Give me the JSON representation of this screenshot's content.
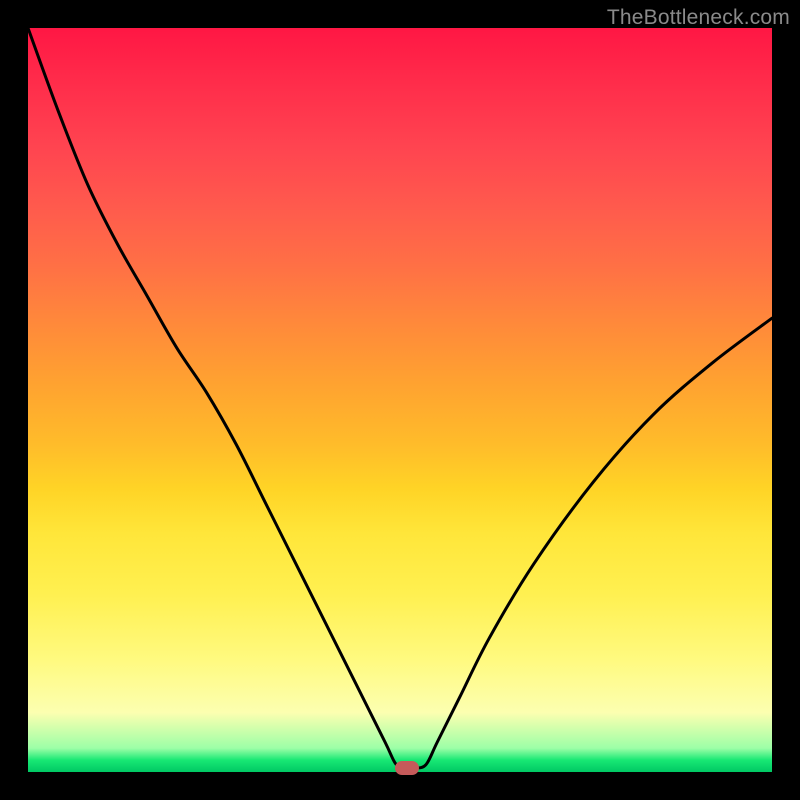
{
  "watermark": "TheBottleneck.com",
  "colors": {
    "frame": "#000000",
    "curve": "#000000",
    "marker": "#c55a5a",
    "gradient_top": "#ff1744",
    "gradient_bottom": "#00c864"
  },
  "chart_data": {
    "type": "line",
    "title": "",
    "xlabel": "",
    "ylabel": "",
    "xlim": [
      0,
      100
    ],
    "ylim": [
      0,
      100
    ],
    "x": [
      0,
      4,
      8,
      12,
      16,
      20,
      24,
      28,
      32,
      36,
      40,
      44,
      48,
      49.5,
      51,
      52,
      53.5,
      55,
      58,
      62,
      68,
      76,
      84,
      92,
      100
    ],
    "values": [
      100,
      89,
      79,
      71,
      64,
      57,
      51,
      44,
      36,
      28,
      20,
      12,
      4,
      1,
      0.5,
      0.5,
      1,
      4,
      10,
      18,
      28,
      39,
      48,
      55,
      61
    ],
    "series": [
      {
        "name": "bottleneck-curve",
        "x_ref": "x",
        "values_ref": "values"
      }
    ],
    "markers": [
      {
        "name": "optimum-marker",
        "x": 51,
        "y": 0.5
      }
    ],
    "annotations": []
  }
}
